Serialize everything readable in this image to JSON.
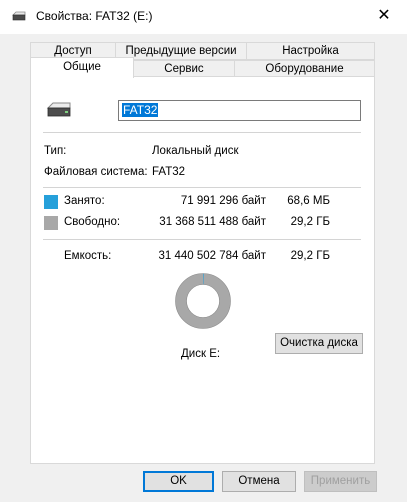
{
  "window": {
    "title": "Свойства: FAT32 (E:)",
    "close_glyph": "✕"
  },
  "tabs_back": [
    "Доступ",
    "Предыдущие версии",
    "Настройка"
  ],
  "tabs_front": [
    "Общие",
    "Сервис",
    "Оборудование"
  ],
  "general": {
    "volume_name": "FAT32",
    "type_label": "Тип:",
    "type_value": "Локальный диск",
    "fs_label": "Файловая система:",
    "fs_value": "FAT32",
    "used": {
      "label": "Занято:",
      "bytes": "71 991 296 байт",
      "size": "68,6 МБ",
      "color": "#26a0da"
    },
    "free": {
      "label": "Свободно:",
      "bytes": "31 368 511 488 байт",
      "size": "29,2 ГБ",
      "color": "#a8a8a8"
    },
    "capacity": {
      "label": "Емкость:",
      "bytes": "31 440 502 784 байт",
      "size": "29,2 ГБ"
    },
    "used_fraction": 0.0023,
    "disk_label": "Диск E:",
    "cleanup_button": "Очистка диска"
  },
  "buttons": {
    "ok": "OK",
    "cancel": "Отмена",
    "apply": "Применить"
  },
  "icons": {
    "drive": "drive-icon",
    "close": "close-icon"
  }
}
